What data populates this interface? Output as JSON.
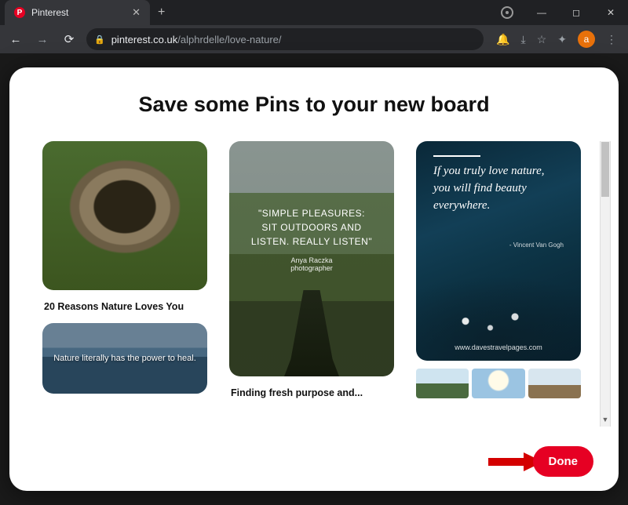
{
  "window": {
    "tab_title": "Pinterest",
    "favicon_letter": "P",
    "avatar_letter": "a"
  },
  "address": {
    "host": "pinterest.co.uk",
    "path": "/alphrdelle/love-nature/"
  },
  "modal": {
    "heading": "Save some Pins to your new board",
    "done_label": "Done"
  },
  "pins": {
    "col1": {
      "p1_title": "20 Reasons Nature Loves You",
      "p2_overlay": "Nature literally has the power to heal."
    },
    "col2": {
      "quote": "\"SIMPLE PLEASURES: SIT OUTDOORS AND LISTEN. REALLY LISTEN\"",
      "attr_name": "Anya Raczka",
      "attr_role": "photographer",
      "title": "Finding fresh purpose and..."
    },
    "col3": {
      "quote": "If you truly love nature, you will find beauty everywhere.",
      "attr": "- Vincent Van Gogh",
      "site": "www.davestravelpages.com"
    }
  }
}
